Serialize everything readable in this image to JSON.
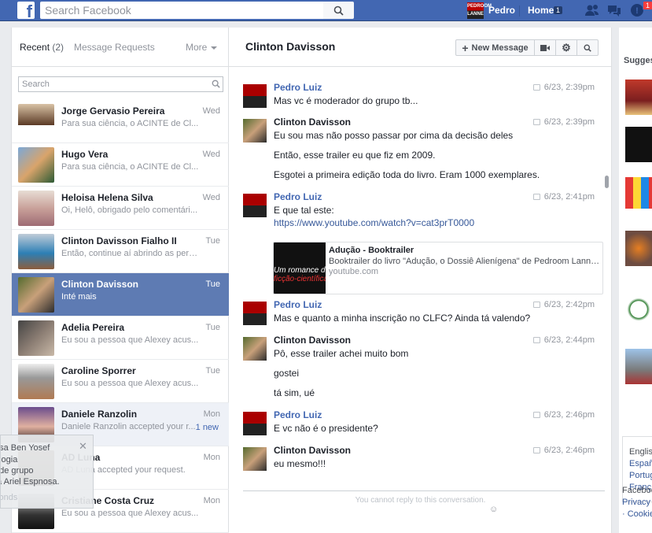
{
  "topbar": {
    "logo_letter": "f",
    "search_placeholder": "Search Facebook",
    "user_name": "Pedro",
    "avatar_text": "PEDROOM LANNE",
    "home_label": "Home",
    "home_count": "1",
    "notif_count": "1",
    "brand_color": "#4267b2"
  },
  "left": {
    "tab_recent": "Recent",
    "tab_recent_count": "(2)",
    "tab_requests": "Message Requests",
    "tab_more": "More",
    "search_placeholder": "Search",
    "threads": [
      {
        "name": "Jorge Gervasio Pereira",
        "snippet": "Para sua ciência, o ACINTE de Cl...",
        "time": "Wed"
      },
      {
        "name": "Hugo Vera",
        "snippet": "Para sua ciência, o ACINTE de Cl...",
        "time": "Wed"
      },
      {
        "name": "Heloisa Helena Silva",
        "snippet": "Oi, Helô, obrigado pelo comentári...",
        "time": "Wed"
      },
      {
        "name": "Clinton Davisson Fialho II",
        "snippet": "Então, continue aí abrindo as pern...",
        "time": "Tue"
      },
      {
        "name": "Clinton Davisson",
        "snippet": "Inté mais",
        "time": "Tue"
      },
      {
        "name": "Adelia Pereira",
        "snippet": "Eu sou a pessoa que Alexey acus...",
        "time": "Tue"
      },
      {
        "name": "Caroline Sporrer",
        "snippet": "Eu sou a pessoa que Alexey acus...",
        "time": "Tue"
      },
      {
        "name": "Daniele Ranzolin",
        "snippet": "Daniele Ranzolin accepted your r...",
        "time": "Mon",
        "new": "1 new"
      },
      {
        "name": "AD Luna",
        "snippet": "AD Luna accepted your request.",
        "time": "Mon"
      },
      {
        "name": "Cristiane Costa Cruz",
        "snippet": "Eu sou a pessoa que Alexey acus...",
        "time": "Mon"
      }
    ],
    "popup_lines": [
      "osa Ben Yosef",
      "ologia",
      "ade grupo",
      "ta Ariel Espnosa.",
      "conds"
    ]
  },
  "convo": {
    "title": "Clinton Davisson",
    "new_message": "New Message",
    "messages": [
      {
        "sender": "Pedro Luiz",
        "time": "6/23, 2:39pm",
        "lines": [
          "Mas vc é moderador do grupo tb..."
        ]
      },
      {
        "sender": "Clinton Davisson",
        "time": "6/23, 2:39pm",
        "lines": [
          "Eu sou mas não posso passar por cima da decisão deles",
          "Então, esse trailer eu que fiz em 2009.",
          "Esgotei a primeira edição toda do livro. Eram 1000 exemplares."
        ]
      },
      {
        "sender": "Pedro Luiz",
        "time": "6/23, 2:41pm",
        "lines": [
          "E que tal este:"
        ],
        "link": "https://www.youtube.com/watch?v=cat3prT0000"
      },
      {
        "sender": "Pedro Luiz",
        "time": "6/23, 2:42pm",
        "lines": [
          "Mas e quanto a minha inscrição no CLFC? Ainda tá valendo?"
        ]
      },
      {
        "sender": "Clinton Davisson",
        "time": "6/23, 2:44pm",
        "lines": [
          "Pô, esse trailer achei muito bom",
          "gostei",
          "tá sim, ué"
        ]
      },
      {
        "sender": "Pedro Luiz",
        "time": "6/23, 2:46pm",
        "lines": [
          "E vc não é o presidente?"
        ]
      },
      {
        "sender": "Clinton Davisson",
        "time": "6/23, 2:46pm",
        "lines": [
          "eu mesmo!!!"
        ]
      }
    ],
    "preview": {
      "title": "Adução - Booktrailer",
      "desc": "Booktrailer do livro \"Adução, o Dossiê Alienígena\" de Pedroom Lanne (...",
      "source": "youtube.com",
      "img_text1": "Um romance de",
      "img_text2": "ficção-científica"
    },
    "cannot_reply": "You cannot reply to this conversation."
  },
  "right": {
    "suggested": "Sugges",
    "langs": [
      "Englis",
      "Españ",
      "Portug",
      "Franç"
    ],
    "footer": [
      "Faceboo",
      "Privacy",
      "· Cookie"
    ]
  }
}
